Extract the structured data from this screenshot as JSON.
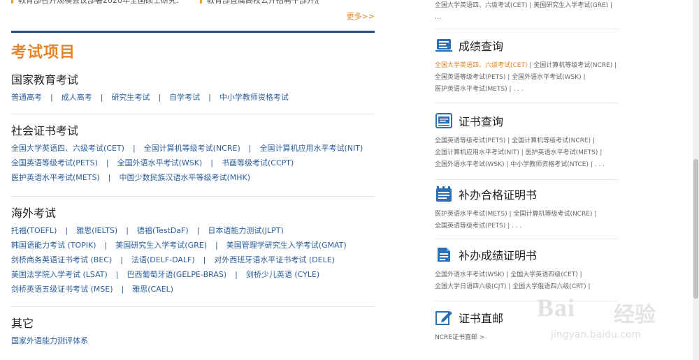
{
  "top_news": {
    "item1": "教育部召开规模会议部署2020年全国硕士研究…",
    "item2": "教育部直属高校公开招聘干部开放",
    "more": "更多>>"
  },
  "section_title": "考试项目",
  "categories": [
    {
      "title": "国家教育考试",
      "lines": [
        [
          "普通高考",
          "成人高考",
          "研究生考试",
          "自学考试",
          "中小学教师资格考试"
        ]
      ]
    },
    {
      "title": "社会证书考试",
      "lines": [
        [
          "全国大学英语四、六级考试(CET)",
          "全国计算机等级考试(NCRE)",
          "全国计算机应用水平考试(NIT)"
        ],
        [
          "全国英语等级考试(PETS)",
          "全国外语水平考试(WSK)",
          "书画等级考试(CCPT)"
        ],
        [
          "医护英语水平考试(METS)",
          "中国少数民族汉语水平等级考试(MHK)"
        ]
      ]
    },
    {
      "title": "海外考试",
      "lines": [
        [
          "托福(TOEFL)",
          "雅思(IELTS)",
          "德福(TestDaF)",
          "日本语能力测试(JLPT)"
        ],
        [
          "韩国语能力考试 (TOPIK)",
          "美国研究生入学考试(GRE)",
          "美国管理学研究生入学考试(GMAT)"
        ],
        [
          "剑桥商务英语证书考试 (BEC)",
          "法语(DELF-DALF)",
          "对外西班牙语水平证书考试 (DELE)"
        ],
        [
          "美国法学院入学考试 (LSAT)",
          "巴西葡萄牙语(GELPE-BRAS)",
          "剑桥少儿英语 (CYLE)"
        ],
        [
          "剑桥英语五级证书考试 (MSE)",
          "雅思(CAEL)"
        ]
      ]
    },
    {
      "title": "其它",
      "lines": [
        [
          "国家外语能力测评体系"
        ]
      ]
    }
  ],
  "right": {
    "top_lines": [
      "全国大学英语四、六级考试(CET)  |  美国研究生入学考试(GRE)  |",
      "..."
    ],
    "blocks": [
      {
        "title": "成绩查询",
        "icon": "score-card-icon",
        "lines": [
          {
            "hl": "全国大学英语四、六级考试(CET)",
            "rest": "| 全国计算机等级考试(NCRE) |"
          },
          {
            "hl": "",
            "rest": "全国英语等级考试(PETS) | 全国外语水平考试(WSK) |"
          },
          {
            "hl": "",
            "rest": "医护英语水平考试(METS) | . . ."
          }
        ]
      },
      {
        "title": "证书查询",
        "icon": "certificate-icon",
        "lines": [
          {
            "hl": "",
            "rest": "全国英语等级考试(PETS) | 全国计算机等级考试(NCRE) |"
          },
          {
            "hl": "",
            "rest": "全国计算机应用水平考试(NIT) | 医护英语水平考试(METS) |"
          },
          {
            "hl": "",
            "rest": "全国外语水平考试(WSK) | 中小学教师资格考试(NTCE) | . . ."
          }
        ]
      },
      {
        "title": "补办合格证明书",
        "icon": "checklist-icon",
        "lines": [
          {
            "hl": "",
            "rest": "医护英语水平考试(METS) | 全国计算机等级考试(NCRE) |"
          },
          {
            "hl": "",
            "rest": "全国英语等级考试(PETS) | . . ."
          }
        ]
      },
      {
        "title": "补办成绩证明书",
        "icon": "document-icon",
        "lines": [
          {
            "hl": "",
            "rest": "全国外语水平考试(WSK) | 全国大学英语四级(CET) |"
          },
          {
            "hl": "",
            "rest": "全国大学日语四六级(CJT) | 全国大学俄语四六级(CRT) |"
          }
        ]
      },
      {
        "title": "证书直邮",
        "icon": "edit-icon",
        "lines": [
          {
            "hl": "",
            "rest": "NCRE证书直邮 >"
          }
        ]
      }
    ]
  },
  "watermark": {
    "logo": "Bai",
    "logo2": "经验",
    "url": "jingyan.baidu.com"
  },
  "colors": {
    "accent": "#e5852b",
    "link": "#2a5f9e",
    "rule": "#1f4e8c"
  }
}
